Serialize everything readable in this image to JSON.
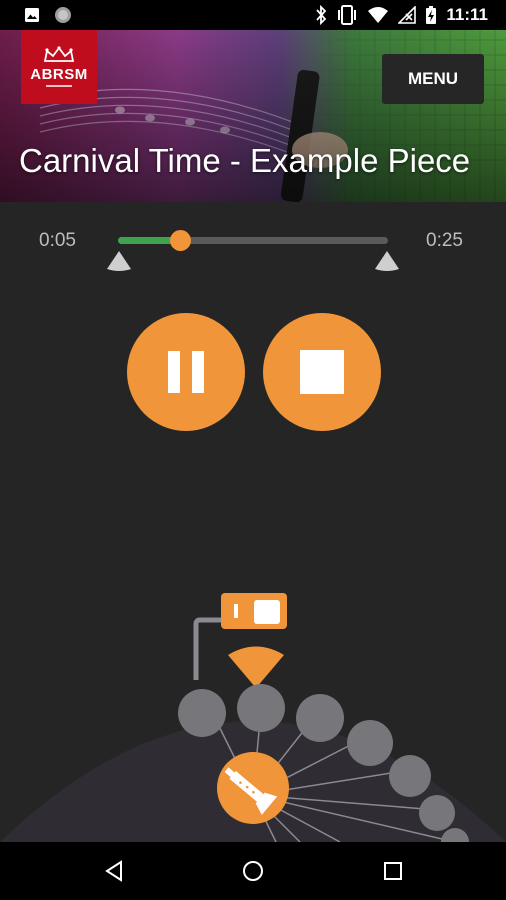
{
  "status_bar": {
    "time": "11:11",
    "icons": [
      "image-notification-icon",
      "circle-notification-icon",
      "bluetooth-icon",
      "vibrate-icon",
      "wifi-icon",
      "no-signal-icon",
      "battery-charging-icon"
    ]
  },
  "header": {
    "logo_text": "ABRSM",
    "menu_label": "MENU",
    "title": "Carnival Time - Example Piece"
  },
  "player": {
    "current_time": "0:05",
    "total_time": "0:25",
    "progress_fraction": 0.23
  },
  "controls": {
    "pause_icon": "pause-icon",
    "stop_icon": "stop-icon"
  },
  "instrument_dial": {
    "instrument_icon": "clarinet-icon",
    "toggle_on": true
  },
  "colors": {
    "accent": "#f0953a",
    "progress_green": "#3fa34d",
    "brand_red": "#c00d1e",
    "background": "#252525"
  },
  "nav_bar": {
    "icons": [
      "back-icon",
      "home-icon",
      "recents-icon"
    ]
  }
}
